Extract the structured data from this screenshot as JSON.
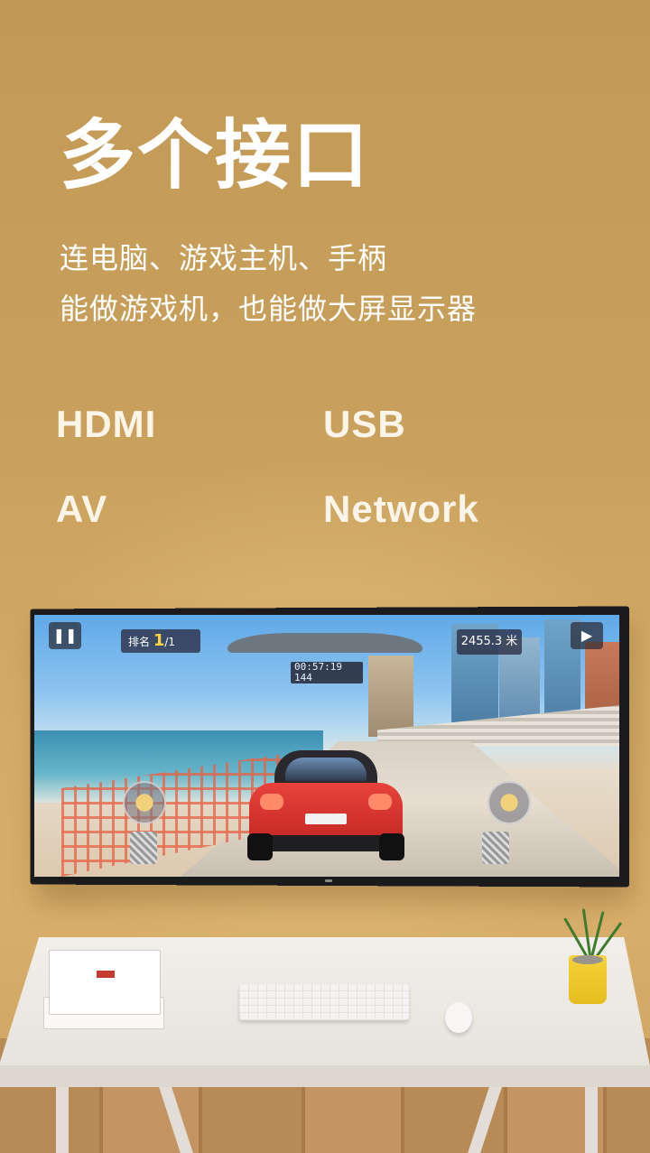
{
  "headline": {
    "title": "多个接口",
    "subtitle_line1": "连电脑、游戏主机、手柄",
    "subtitle_line2": "能做游戏机，也能做大屏显示器"
  },
  "ports": [
    "HDMI",
    "USB",
    "AV",
    "Network"
  ],
  "game_hud": {
    "rank_label": "排名",
    "rank_value": "1",
    "rank_total": "/1",
    "timer": "00:57:19",
    "speed": "144",
    "distance": "2455.3 米"
  },
  "colors": {
    "wall": "#c8a05c",
    "text": "#ffffff",
    "port_text": "#fbf4e8",
    "car": "#d6302a",
    "pot": "#f2cc2f"
  }
}
